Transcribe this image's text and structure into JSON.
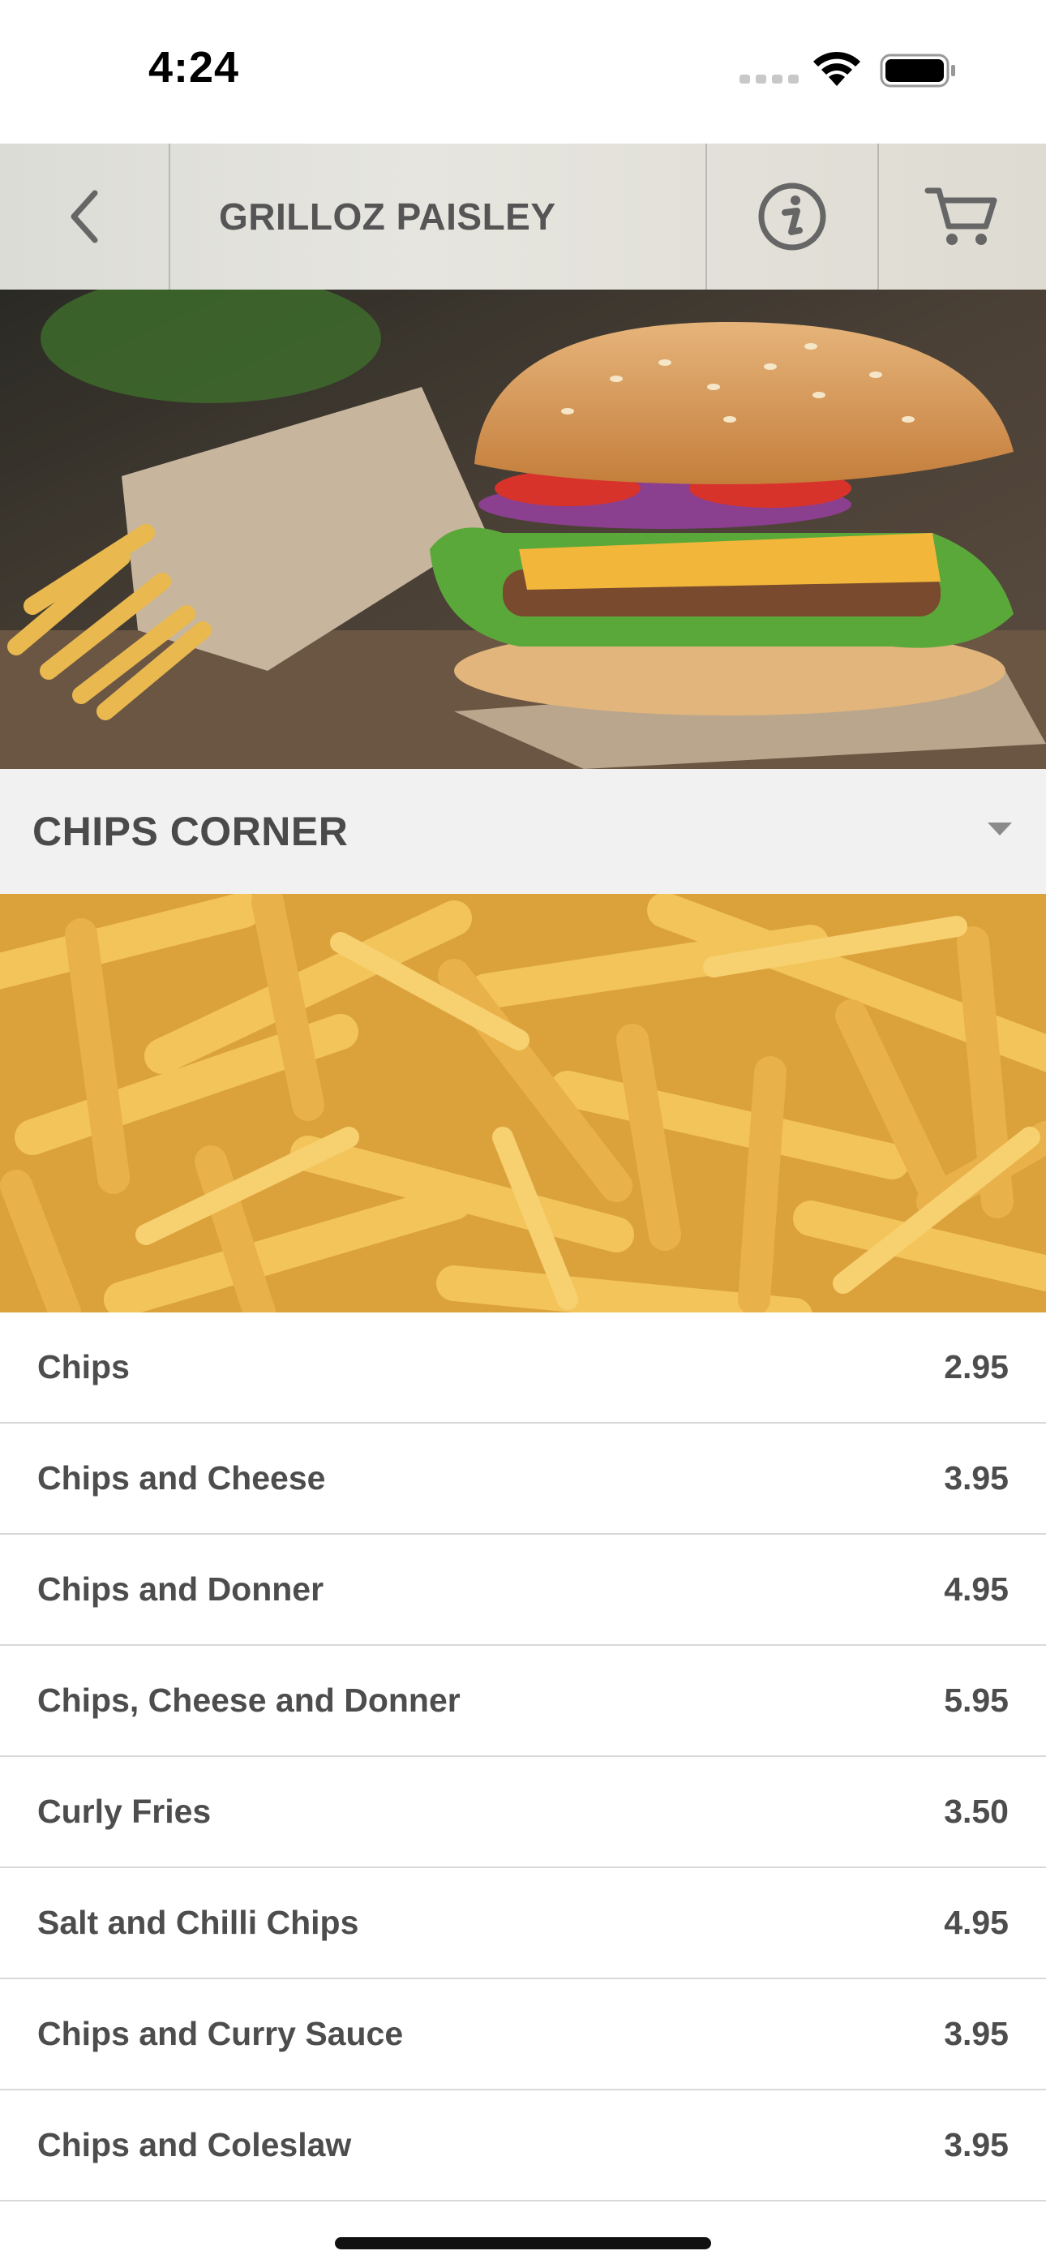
{
  "status_bar": {
    "time": "4:24"
  },
  "nav": {
    "title": "GRILLOZ PAISLEY",
    "back_icon": "chevron-left-icon",
    "info_icon": "info-icon",
    "cart_icon": "cart-icon"
  },
  "hero": {
    "image": "burger-and-fries-photo"
  },
  "category": {
    "title": "CHIPS CORNER",
    "caret_icon": "caret-down-icon"
  },
  "category_image": "french-fries-photo",
  "menu": {
    "items": [
      {
        "name": "Chips",
        "price": "2.95"
      },
      {
        "name": "Chips and Cheese",
        "price": "3.95"
      },
      {
        "name": "Chips and Donner",
        "price": "4.95"
      },
      {
        "name": "Chips, Cheese and Donner",
        "price": "5.95"
      },
      {
        "name": "Curly Fries",
        "price": "3.50"
      },
      {
        "name": "Salt and Chilli Chips",
        "price": "4.95"
      },
      {
        "name": "Chips and Curry Sauce",
        "price": "3.95"
      },
      {
        "name": "Chips and Coleslaw",
        "price": "3.95"
      }
    ]
  }
}
